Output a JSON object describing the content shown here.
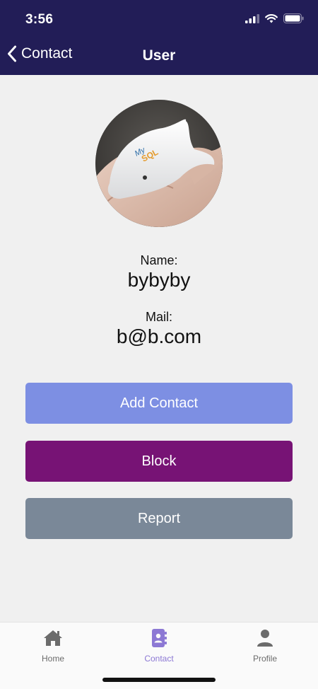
{
  "status_bar": {
    "time": "3:56"
  },
  "nav": {
    "back_label": "Contact",
    "title": "User"
  },
  "profile": {
    "avatar_alt": "",
    "name_label": "Name:",
    "name_value": "bybyby",
    "mail_label": "Mail:",
    "mail_value": "b@b.com"
  },
  "actions": {
    "add_contact": "Add Contact",
    "block": "Block",
    "report": "Report"
  },
  "tabbar": {
    "active": "contact",
    "items": [
      {
        "id": "home",
        "label": "Home",
        "icon": "home-icon"
      },
      {
        "id": "contact",
        "label": "Contact",
        "icon": "contact-book-icon"
      },
      {
        "id": "profile",
        "label": "Profile",
        "icon": "person-icon"
      }
    ]
  },
  "colors": {
    "header_bg": "#221d57",
    "add_contact_bg": "#7d8fe3",
    "block_bg": "#771375",
    "report_bg": "#7a8898",
    "tab_active": "#8c78d4",
    "tab_inactive": "#6b6b6b"
  }
}
